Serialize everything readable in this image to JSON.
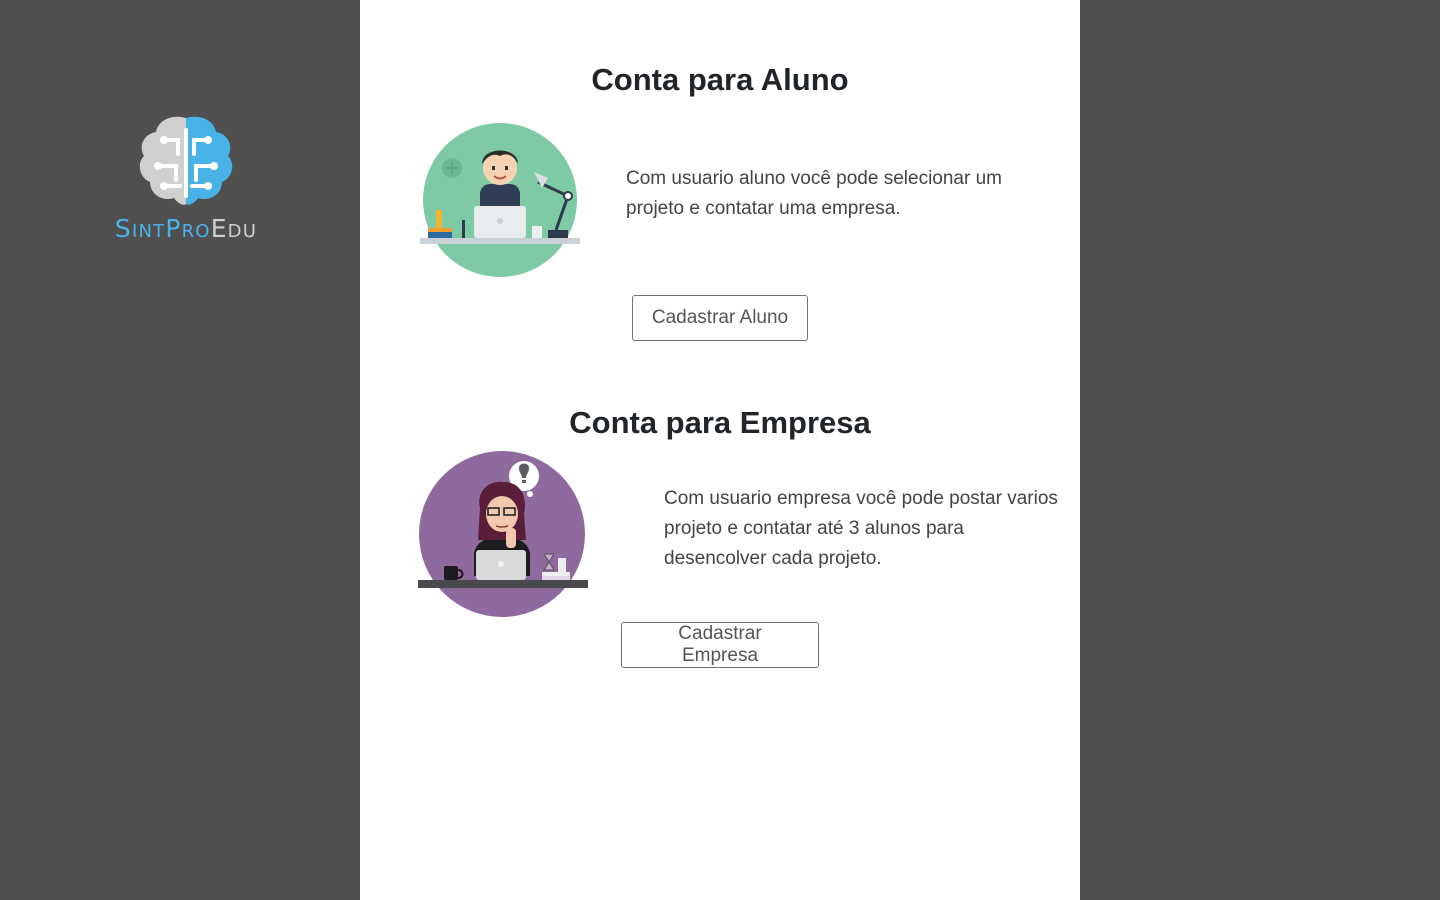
{
  "brand": {
    "logo_text_part1": "Sint",
    "logo_text_part2": "Pro",
    "logo_text_part3": "Edu"
  },
  "aluno": {
    "title": "Conta para Aluno",
    "description": "Com usuario aluno você pode selecionar um projeto e contatar uma empresa.",
    "button_label": "Cadastrar Aluno"
  },
  "empresa": {
    "title": "Conta para Empresa",
    "description": "Com usuario empresa você pode postar varios projeto e contatar até 3 alunos para desencolver cada projeto.",
    "button_label": "Cadastrar Empresa"
  },
  "colors": {
    "background": "#4f4f4f",
    "panel": "#ffffff",
    "brand_blue": "#49b3e8",
    "brand_gray": "#cfcfcf",
    "aluno_circle": "#7ecaa5",
    "empresa_circle": "#8e6a9e"
  }
}
